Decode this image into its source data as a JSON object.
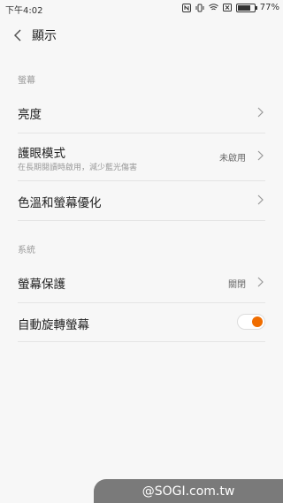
{
  "status": {
    "time": "下午4:02",
    "battery_percent": "77%",
    "battery_level": 0.77,
    "icons": [
      "nfc-icon",
      "vibrate-icon",
      "wifi-icon",
      "sim-icon",
      "battery-icon"
    ]
  },
  "header": {
    "title": "顯示"
  },
  "sections": [
    {
      "title": "螢幕",
      "rows": [
        {
          "label": "亮度"
        },
        {
          "label": "護眼模式",
          "sub": "在長期閱讀時啟用，減少藍光傷害",
          "value": "未啟用"
        },
        {
          "label": "色溫和螢幕優化"
        }
      ]
    },
    {
      "title": "系統",
      "rows": [
        {
          "label": "螢幕保護",
          "value": "關閉"
        },
        {
          "label": "自動旋轉螢幕",
          "toggle_on": true
        }
      ]
    }
  ],
  "watermark": "@SOGI.com.tw",
  "colors": {
    "accent": "#f06d00",
    "background": "#f7f7f7",
    "divider": "#e4e4e4"
  }
}
